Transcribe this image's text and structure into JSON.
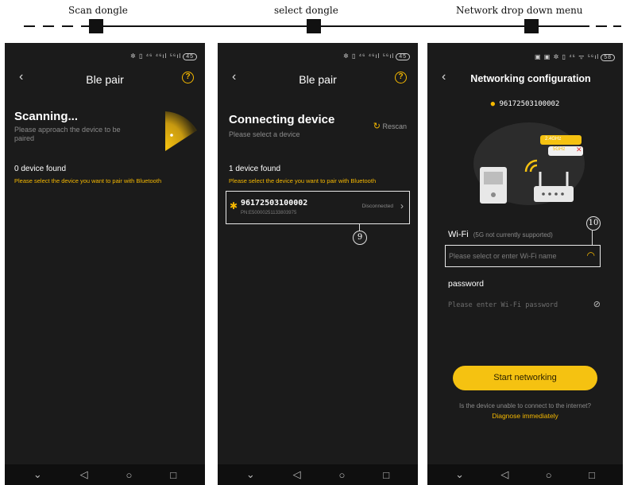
{
  "captions": {
    "scan": "Scan dongle",
    "select": "select dongle",
    "network": "Network drop down menu"
  },
  "status": {
    "icons_1": "✲ ▯ ⁴⁶ ⁴⁶ıl ⁵⁶ıl",
    "battery_1": "45",
    "icons_2": "✲ ▯ ⁴⁶ ⁴⁶ıl ⁵⁶ıl",
    "battery_2": "45",
    "icons_3": "▣ ▣ ✲ ▯ ⁴⁶ ᯤ ⁵⁶ıl",
    "battery_3": "58"
  },
  "screen1": {
    "title": "Ble pair",
    "heading": "Scanning...",
    "sub": "Please approach the device to be paired",
    "found": "0 device found",
    "hint": "Please select the device you want to pair with Bluetooth"
  },
  "screen2": {
    "title": "Ble pair",
    "heading": "Connecting device",
    "sub": "Please select a device",
    "rescan": "Rescan",
    "found": "1 device found",
    "hint": "Please select the device you want to pair with Bluetooth",
    "device": {
      "name": "96172503100002",
      "pn": "PN:E50000251133803975",
      "status": "Disconnected"
    },
    "callout": "9"
  },
  "screen3": {
    "title": "Networking configuration",
    "device_id": "96172503100002",
    "bubble_24": "2.4GHz",
    "bubble_5": "5GHz",
    "wifi_label": "Wi-Fi",
    "wifi_note": "(5G not currently supported)",
    "wifi_placeholder": "Please select or enter Wi-Fi name",
    "password_label": "password",
    "password_placeholder": "Please enter Wi-Fi password",
    "start_button": "Start networking",
    "trouble_text": "Is the device unable to connect to the internet?",
    "diagnose_link": "Diagnose immediately",
    "callout": "10"
  },
  "colors": {
    "accent": "#f5c211",
    "bg": "#1b1b1b"
  }
}
